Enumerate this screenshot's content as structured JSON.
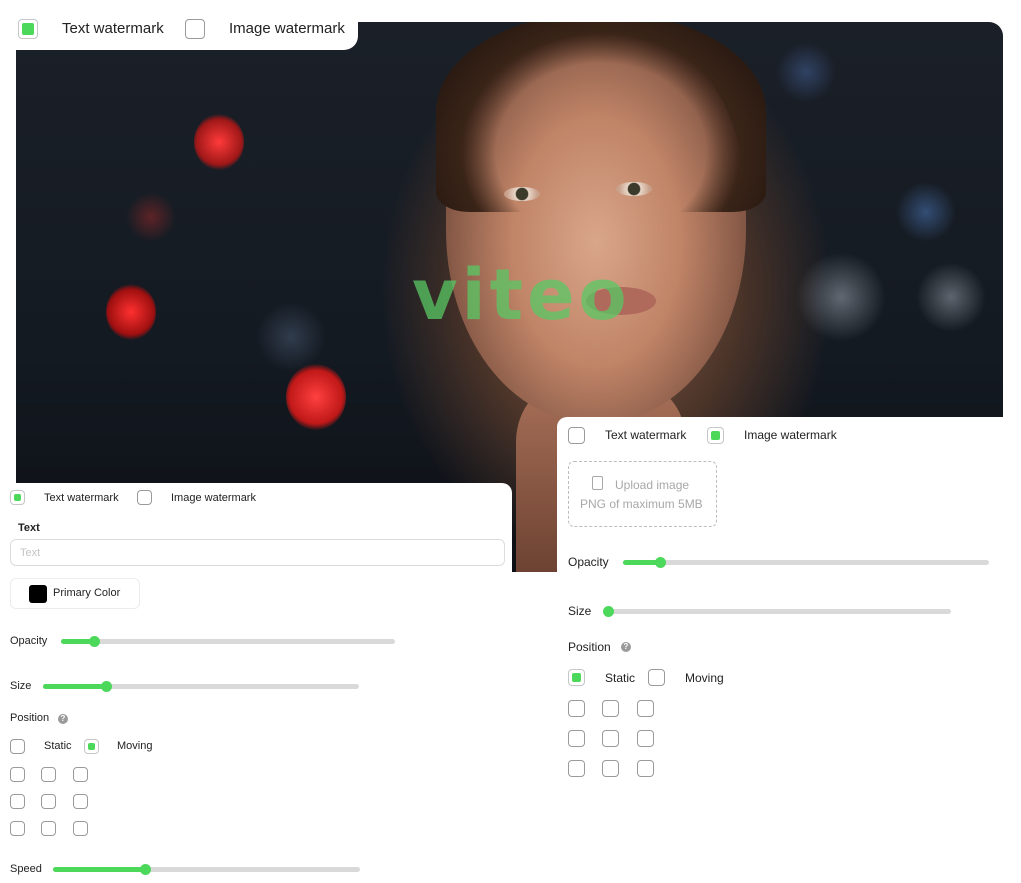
{
  "top_tab": {
    "text_watermark": {
      "label": "Text watermark",
      "checked": true
    },
    "image_watermark": {
      "label": "Image watermark",
      "checked": false
    }
  },
  "preview": {
    "watermark_text": "viteo",
    "watermark_color": "#58c864"
  },
  "left_panel": {
    "text_watermark": {
      "label": "Text watermark",
      "checked": true
    },
    "image_watermark": {
      "label": "Image watermark",
      "checked": false
    },
    "text_field": {
      "label": "Text",
      "value": "",
      "placeholder": "Text"
    },
    "primary_color": {
      "label": "Primary Color",
      "color": "#000000"
    },
    "opacity": {
      "label": "Opacity",
      "value": 0.1
    },
    "size": {
      "label": "Size",
      "value": 0.2
    },
    "position": {
      "label": "Position",
      "help_icon": "question-icon",
      "static": {
        "label": "Static",
        "checked": false
      },
      "moving": {
        "label": "Moving",
        "checked": true
      }
    },
    "speed": {
      "label": "Speed",
      "value": 0.3
    }
  },
  "right_panel": {
    "text_watermark": {
      "label": "Text watermark",
      "checked": false
    },
    "image_watermark": {
      "label": "Image watermark",
      "checked": true
    },
    "upload": {
      "title": "Upload image",
      "subtitle": "PNG of maximum 5MB",
      "icon": "file-icon"
    },
    "opacity": {
      "label": "Opacity",
      "value": 0.1
    },
    "size": {
      "label": "Size",
      "value": 0.0
    },
    "position": {
      "label": "Position",
      "help_icon": "question-icon",
      "static": {
        "label": "Static",
        "checked": true
      },
      "moving": {
        "label": "Moving",
        "checked": false
      }
    }
  },
  "colors": {
    "accent": "#4cd85a",
    "track": "#d9d9d9"
  }
}
